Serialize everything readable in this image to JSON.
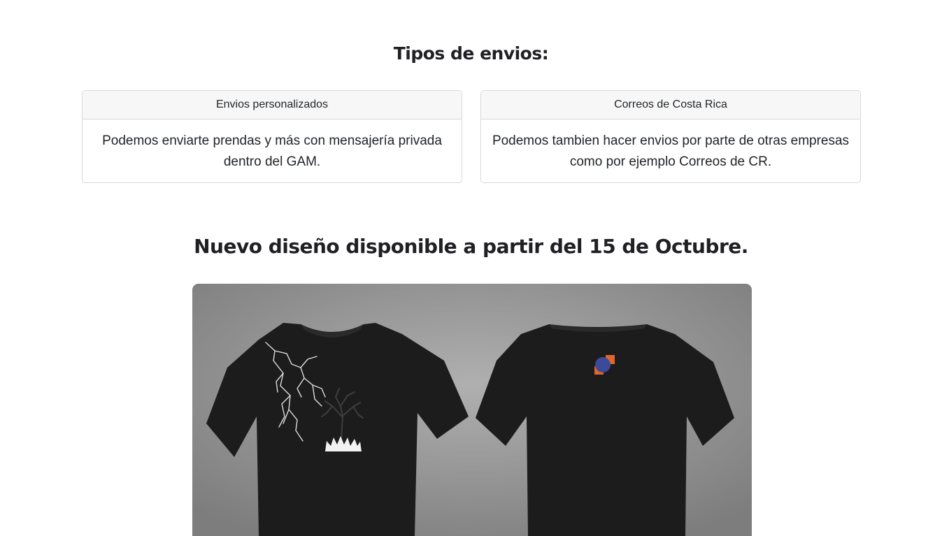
{
  "shipping": {
    "title": "Tipos de envios:",
    "cards": [
      {
        "header": "Envios personalizados",
        "body": "Podemos enviarte prendas y más con mensajería privada dentro del GAM."
      },
      {
        "header": "Correos de Costa Rica",
        "body": "Podemos tambien hacer envios por parte de otras empresas como por ejemplo Correos de CR."
      }
    ]
  },
  "new_design": {
    "title": "Nuevo diseño disponible a partir del 15 de Octubre."
  },
  "colors": {
    "shirt": "#1c1c1c",
    "logo_orange": "#e0662a",
    "logo_blue": "#3d4a9a"
  }
}
